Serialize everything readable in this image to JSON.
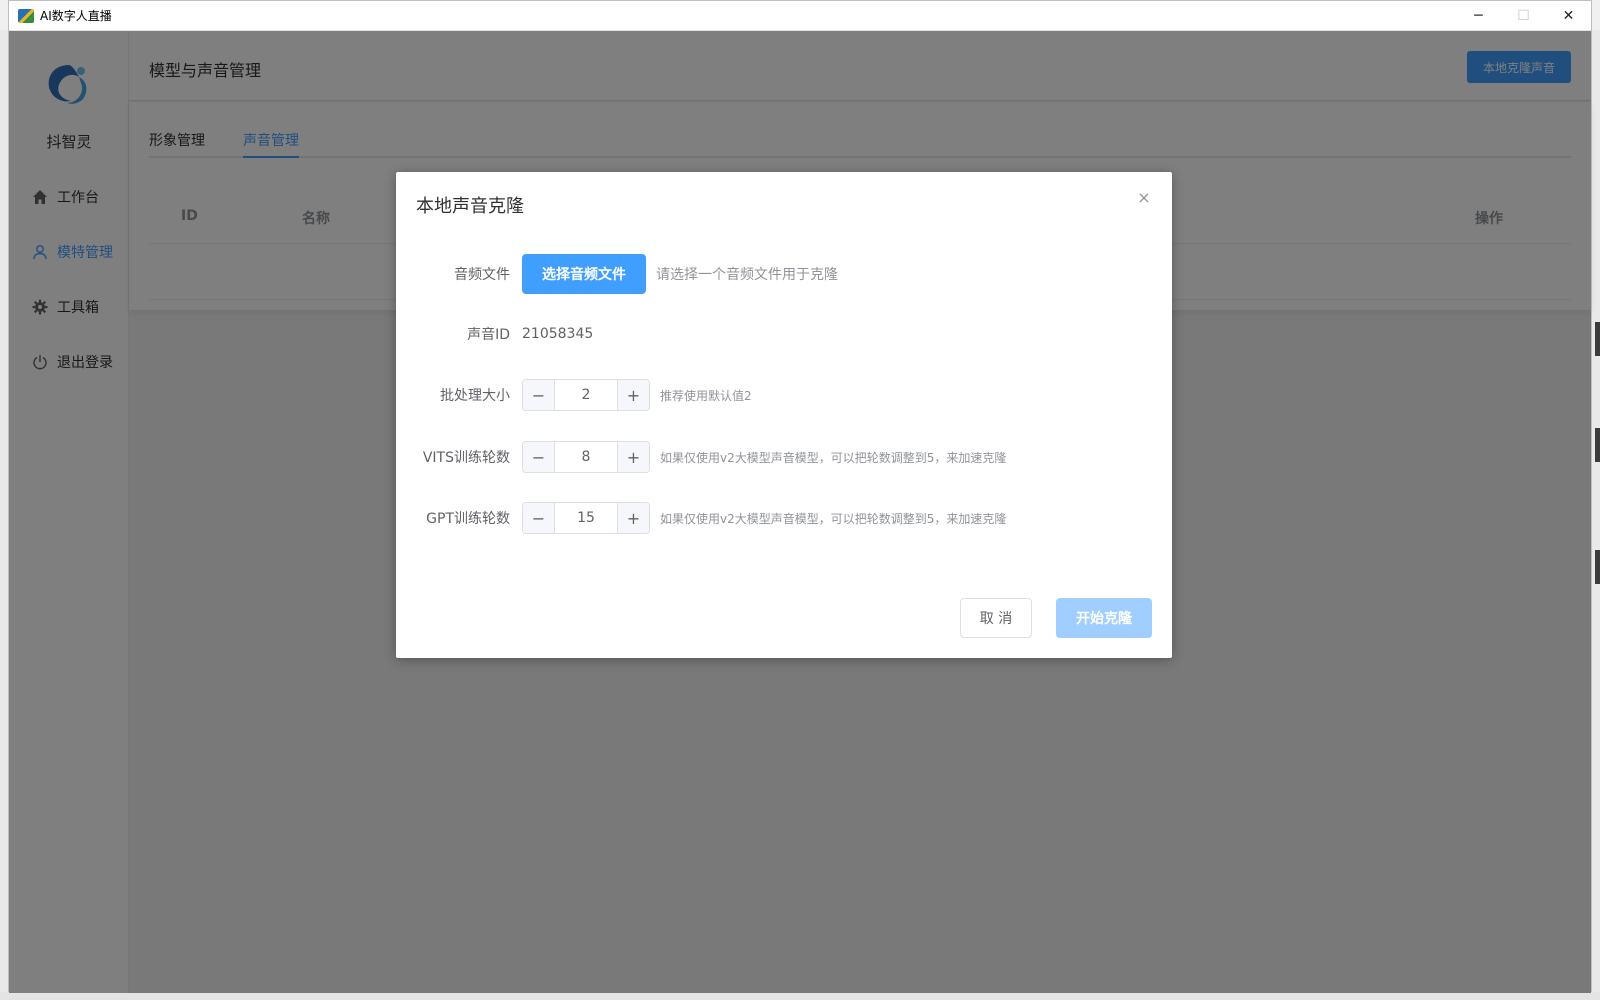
{
  "window": {
    "title": "AI数字人直播",
    "minimize_glyph": "─",
    "maximize_glyph": "☐",
    "close_glyph": "✕"
  },
  "sidebar": {
    "brand": "抖智灵",
    "items": [
      {
        "label": "工作台",
        "icon": "home-icon"
      },
      {
        "label": "模特管理",
        "icon": "user-icon"
      },
      {
        "label": "工具箱",
        "icon": "gear-icon"
      },
      {
        "label": "退出登录",
        "icon": "power-icon"
      }
    ]
  },
  "header": {
    "title": "模型与声音管理",
    "primary_button": "本地克隆声音"
  },
  "tabs": [
    {
      "label": "形象管理"
    },
    {
      "label": "声音管理"
    }
  ],
  "table": {
    "columns": [
      "ID",
      "名称",
      "操作"
    ]
  },
  "dialog": {
    "title": "本地声音克隆",
    "close_glyph": "×",
    "audio": {
      "label": "音频文件",
      "button": "选择音频文件",
      "tip": "请选择一个音频文件用于克隆"
    },
    "voice_id": {
      "label": "声音ID",
      "value": "21058345"
    },
    "batch_size": {
      "label": "批处理大小",
      "value": "2",
      "tip": "推荐使用默认值2"
    },
    "vits_epochs": {
      "label": "VITS训练轮数",
      "value": "8",
      "tip": "如果仅使用v2大模型声音模型，可以把轮数调整到5，来加速克隆"
    },
    "gpt_epochs": {
      "label": "GPT训练轮数",
      "value": "15",
      "tip": "如果仅使用v2大模型声音模型，可以把轮数调整到5，来加速克隆"
    },
    "minus_glyph": "−",
    "plus_glyph": "+",
    "cancel": "取 消",
    "start": "开始克隆"
  },
  "colors": {
    "primary": "#409eff",
    "primary_disabled": "#a0cfff",
    "overlay": "rgba(0,0,0,0.5)"
  }
}
